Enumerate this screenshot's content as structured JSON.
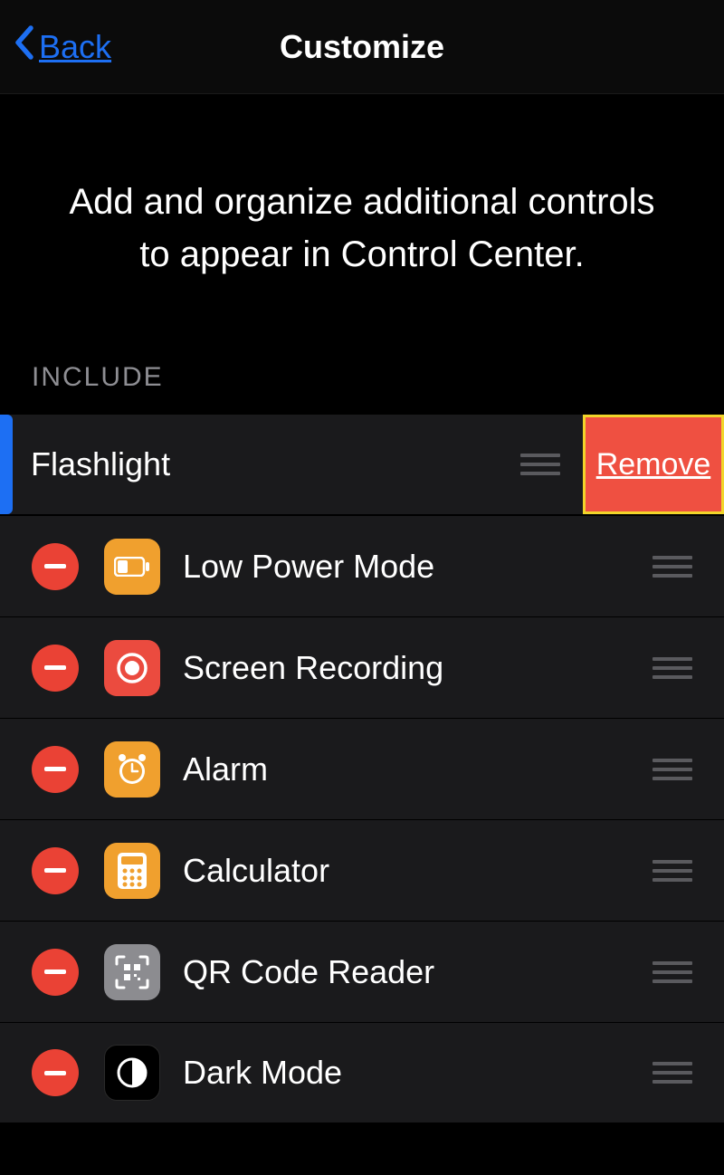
{
  "nav": {
    "back_label": "Back",
    "title": "Customize"
  },
  "description": "Add and organize additional controls to appear in Control Center.",
  "section_header": "INCLUDE",
  "swiped_item": {
    "label": "Flashlight",
    "remove_label": "Remove"
  },
  "items": [
    {
      "label": "Low Power Mode",
      "icon": "battery-icon",
      "icon_bg": "icon-orange"
    },
    {
      "label": "Screen Recording",
      "icon": "record-icon",
      "icon_bg": "icon-red"
    },
    {
      "label": "Alarm",
      "icon": "clock-icon",
      "icon_bg": "icon-orange"
    },
    {
      "label": "Calculator",
      "icon": "calculator-icon",
      "icon_bg": "icon-orange"
    },
    {
      "label": "QR Code Reader",
      "icon": "qr-icon",
      "icon_bg": "icon-gray"
    },
    {
      "label": "Dark Mode",
      "icon": "darkmode-icon",
      "icon_bg": "icon-black"
    }
  ]
}
